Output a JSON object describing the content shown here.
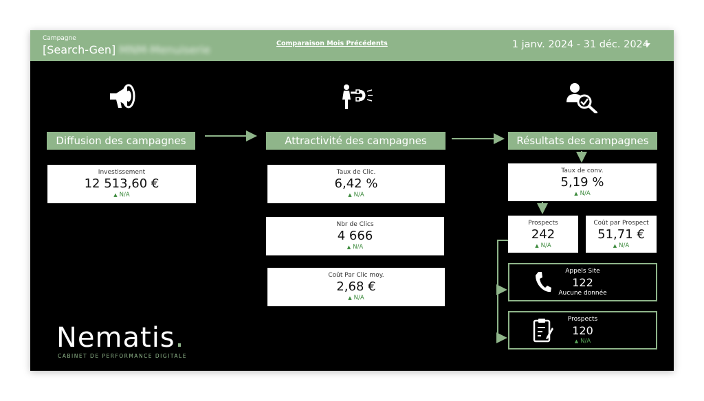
{
  "header": {
    "campaign_label": "Campagne",
    "campaign_value": "[Search-Gen]",
    "campaign_value_blurred": "MNM-Menuiserie",
    "compare_link": "Comparaison Mois Précédents",
    "date_range": "1 janv. 2024 - 31 déc. 2024"
  },
  "sections": {
    "diffusion": "Diffusion des campagnes",
    "attractivite": "Attractivité des campagnes",
    "resultats": "Résultats des campagnes"
  },
  "kpis": {
    "investissement": {
      "label": "Investissement",
      "value": "12 513,60 €",
      "delta": "N/A"
    },
    "taux_clic": {
      "label": "Taux de Clic.",
      "value": "6,42 %",
      "delta": "N/A"
    },
    "nbr_clics": {
      "label": "Nbr de Clics",
      "value": "4 666",
      "delta": "N/A"
    },
    "cout_clic": {
      "label": "Coût Par Clic moy.",
      "value": "2,68 €",
      "delta": "N/A"
    },
    "taux_conv": {
      "label": "Taux de conv.",
      "value": "5,19 %",
      "delta": "N/A"
    },
    "prospects": {
      "label": "Prospects",
      "value": "242",
      "delta": "N/A"
    },
    "cout_prospect": {
      "label": "Coût par Prospect",
      "value": "51,71 €",
      "delta": "N/A"
    },
    "appels_site": {
      "label": "Appels Site",
      "value": "122",
      "sub": "Aucune donnée"
    },
    "prospects_form": {
      "label": "Prospects",
      "value": "120",
      "delta": "N/A"
    }
  },
  "logo": {
    "name": "Nematis",
    "dot": ".",
    "tagline": "CABINET DE PERFORMANCE DIGITALE"
  },
  "icons": {
    "diffusion": "megaphone-icon",
    "attractivite": "magnet-icon",
    "resultats": "user-search-icon",
    "appels": "phone-icon",
    "form": "clipboard-icon"
  },
  "colors": {
    "accent": "#8fb58a",
    "background": "#000000",
    "delta_positive": "#3c8a3c"
  }
}
